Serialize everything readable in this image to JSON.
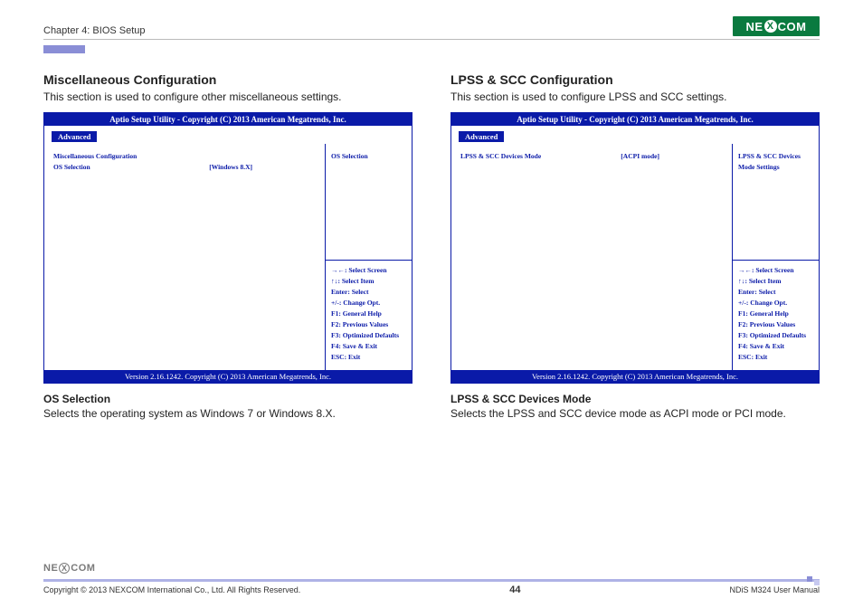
{
  "header": {
    "chapter": "Chapter 4: BIOS Setup",
    "logo_text_left": "NE",
    "logo_text_x": "X",
    "logo_text_right": "COM"
  },
  "left": {
    "title": "Miscellaneous Configuration",
    "subtitle": "This section is used to configure other miscellaneous settings.",
    "bios": {
      "title": "Aptio Setup Utility - Copyright (C) 2013 American Megatrends, Inc.",
      "tab": "Advanced",
      "main_heading": "Miscellaneous Configuration",
      "row1_label": "OS Selection",
      "row1_value": "[Windows 8.X]",
      "side_top": "OS Selection",
      "help": {
        "l1": "→←: Select Screen",
        "l2": "↑↓: Select Item",
        "l3": "Enter: Select",
        "l4": "+/-: Change Opt.",
        "l5": "F1: General Help",
        "l6": "F2: Previous Values",
        "l7": "F3: Optimized Defaults",
        "l8": "F4: Save & Exit",
        "l9": "ESC: Exit"
      },
      "footer": "Version 2.16.1242. Copyright (C) 2013 American Megatrends, Inc."
    },
    "para_head": "OS Selection",
    "para_body": "Selects the operating system as Windows 7 or Windows 8.X."
  },
  "right": {
    "title": "LPSS & SCC Configuration",
    "subtitle": "This section is used to configure LPSS and SCC settings.",
    "bios": {
      "title": "Aptio Setup Utility - Copyright (C) 2013 American Megatrends, Inc.",
      "tab": "Advanced",
      "row1_label": "LPSS & SCC Devices Mode",
      "row1_value": "[ACPI mode]",
      "side_top": "LPSS & SCC Devices Mode Settings",
      "help": {
        "l1": "→←: Select Screen",
        "l2": "↑↓: Select Item",
        "l3": "Enter: Select",
        "l4": "+/-: Change Opt.",
        "l5": "F1: General Help",
        "l6": "F2: Previous Values",
        "l7": "F3: Optimized Defaults",
        "l8": "F4: Save & Exit",
        "l9": "ESC: Exit"
      },
      "footer": "Version 2.16.1242. Copyright (C) 2013 American Megatrends, Inc."
    },
    "para_head": "LPSS & SCC Devices Mode",
    "para_body": "Selects the LPSS and SCC device mode as ACPI mode or PCI mode."
  },
  "footer": {
    "copyright": "Copyright © 2013 NEXCOM International Co., Ltd. All Rights Reserved.",
    "page": "44",
    "manual": "NDiS M324 User Manual"
  }
}
